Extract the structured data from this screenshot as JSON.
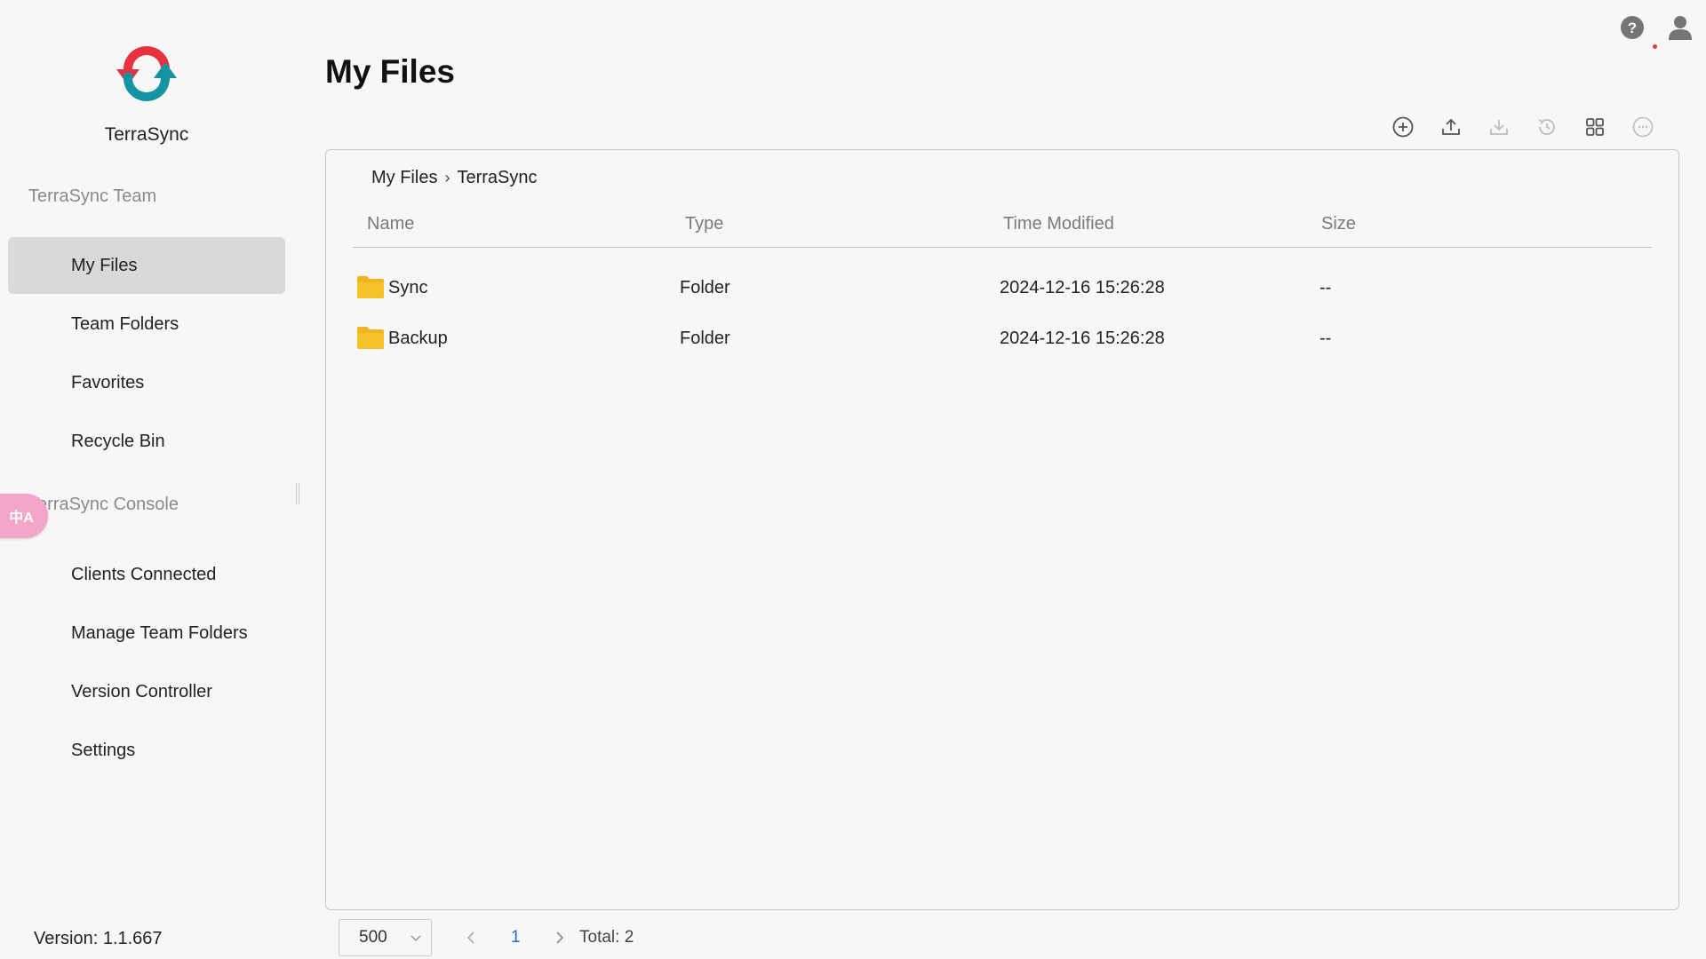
{
  "app": {
    "name": "TerraSync",
    "version": "Version: 1.1.667"
  },
  "sidebar": {
    "sections": [
      {
        "label": "TerraSync Team",
        "items": [
          {
            "label": "My Files",
            "active": true
          },
          {
            "label": "Team Folders"
          },
          {
            "label": "Favorites"
          },
          {
            "label": "Recycle Bin"
          }
        ]
      },
      {
        "label": "TerraSync Console",
        "items": [
          {
            "label": "Clients Connected"
          },
          {
            "label": "Manage Team Folders"
          },
          {
            "label": "Version Controller"
          },
          {
            "label": "Settings"
          }
        ]
      }
    ]
  },
  "translate_badge": "中A",
  "header": {
    "title": "My Files"
  },
  "breadcrumb": [
    "My Files",
    "TerraSync"
  ],
  "table": {
    "columns": [
      "Name",
      "Type",
      "Time Modified",
      "Size"
    ],
    "rows": [
      {
        "name": "Sync",
        "type": "Folder",
        "modified": "2024-12-16 15:26:28",
        "size": "--"
      },
      {
        "name": "Backup",
        "type": "Folder",
        "modified": "2024-12-16 15:26:28",
        "size": "--"
      }
    ]
  },
  "pagination": {
    "page_size": "500",
    "current_page": "1",
    "total": "Total: 2"
  },
  "colors": {
    "logo_red": "#e8323f",
    "logo_teal": "#1494a3",
    "accent_link": "#1a73c9",
    "folder_yellow": "#f7c227"
  }
}
